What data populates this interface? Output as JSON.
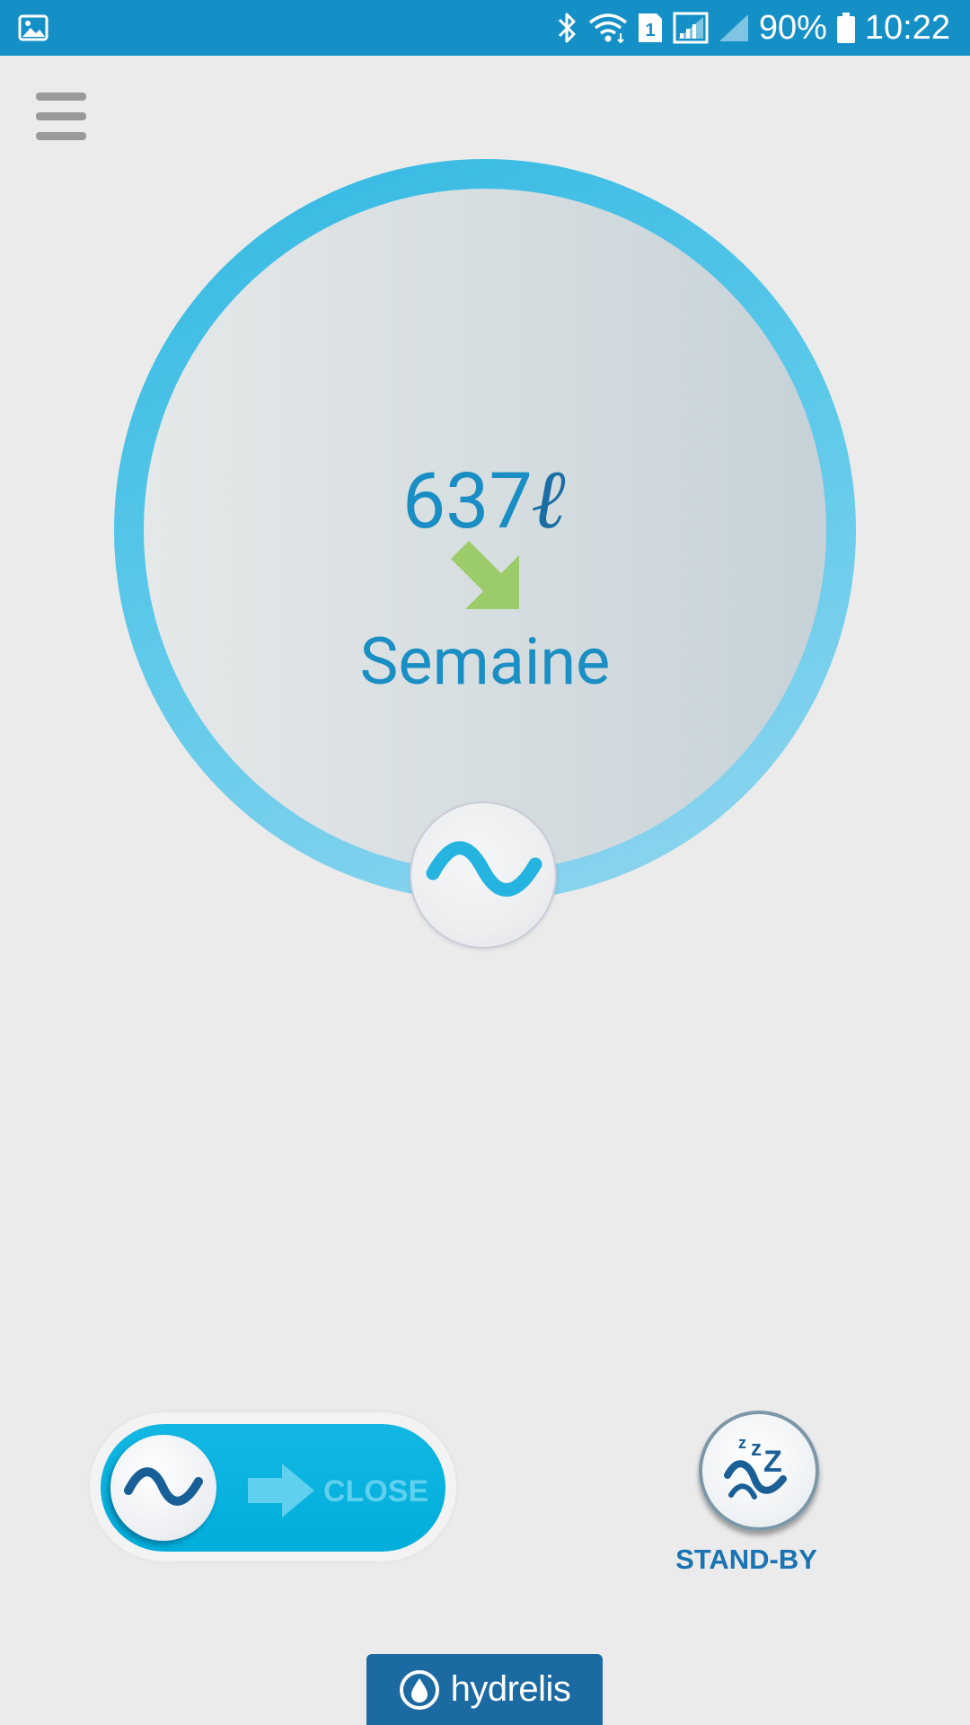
{
  "status_bar": {
    "battery_level": "90%",
    "time": "10:22",
    "sim_slot": "1",
    "icons": [
      "gallery-icon",
      "bluetooth-icon",
      "wifi-icon",
      "sim-icon",
      "signal-icon",
      "signal-icon-2",
      "battery-icon"
    ]
  },
  "menu": {
    "icon": "hamburger-menu-icon"
  },
  "gauge": {
    "value": "637",
    "unit": "ℓ",
    "trend": "down-right-arrow-icon",
    "period": "Semaine",
    "knob_icon": "wave-icon"
  },
  "slider": {
    "label": "CLOSE",
    "knob_icon": "wave-icon",
    "arrow_icon": "arrow-right-icon"
  },
  "standby": {
    "label": "STAND-BY",
    "icon": "sleep-zzz-icon"
  },
  "brand": {
    "name": "hydrelis",
    "logo_icon": "water-drop-icon"
  },
  "colors": {
    "status_bar": "#1590c6",
    "accent_blue": "#1a8ec4",
    "ring_blue": "#32b8e2",
    "slider_blue": "#00aedb",
    "trend_green": "#9ccb6a",
    "brand_blue": "#1c6aa2",
    "background": "#ebebeb"
  }
}
